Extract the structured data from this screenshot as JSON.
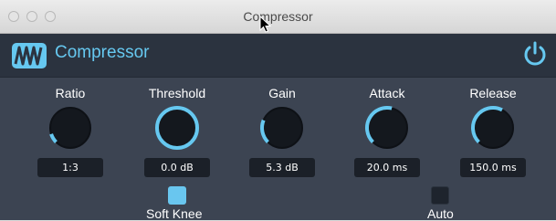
{
  "window": {
    "title": "Compressor"
  },
  "plugin": {
    "name": "Compressor"
  },
  "controls": [
    {
      "label": "Ratio",
      "value": "1:3",
      "level": 0.1
    },
    {
      "label": "Threshold",
      "value": "0.0 dB",
      "level": 1.0
    },
    {
      "label": "Gain",
      "value": "5.3 dB",
      "level": 0.25
    },
    {
      "label": "Attack",
      "value": "20.0 ms",
      "level": 0.55
    },
    {
      "label": "Release",
      "value": "150.0 ms",
      "level": 0.6
    }
  ],
  "toggles": [
    {
      "label": "Soft Knee",
      "on": true
    },
    {
      "label": "Auto",
      "on": false
    }
  ],
  "colors": {
    "accent": "#66c8f0",
    "panel": "#3c4452",
    "header": "#2b333f",
    "knob_track": "#14181e"
  }
}
